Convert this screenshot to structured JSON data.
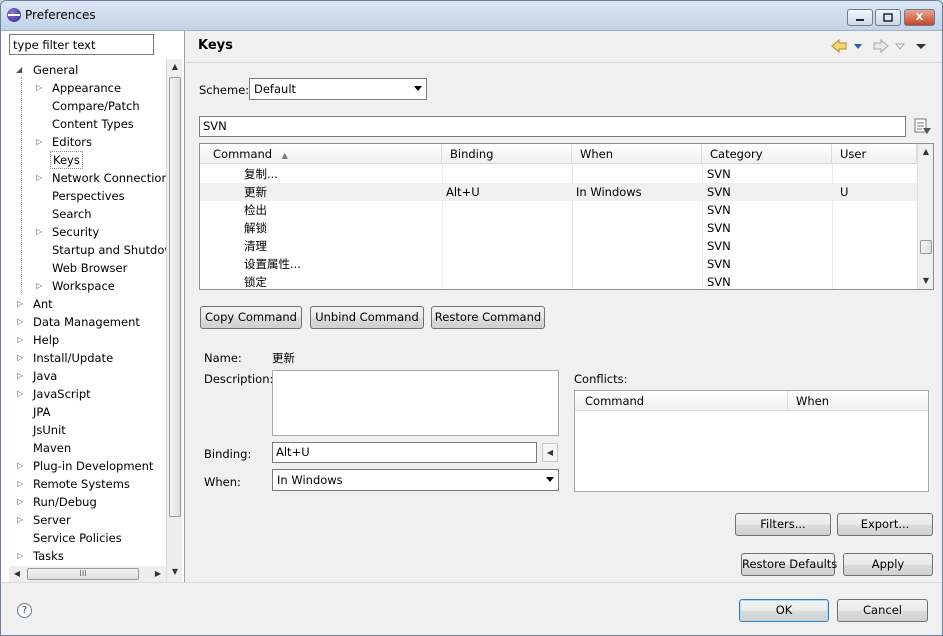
{
  "window": {
    "title": "Preferences",
    "minimize": "▭",
    "maximize": "□",
    "close": "X"
  },
  "filter": {
    "placeholder": "type filter text"
  },
  "tree": {
    "general": "General",
    "general_children": [
      "Appearance",
      "Compare/Patch",
      "Content Types",
      "Editors",
      "Keys",
      "Network Connections",
      "Perspectives",
      "Search",
      "Security",
      "Startup and Shutdown",
      "Web Browser",
      "Workspace"
    ],
    "top_level": [
      "Ant",
      "Data Management",
      "Help",
      "Install/Update",
      "Java",
      "JavaScript",
      "JPA",
      "JsUnit",
      "Maven",
      "Plug-in Development",
      "Remote Systems",
      "Run/Debug",
      "Server",
      "Service Policies",
      "Tasks"
    ],
    "hscroll_grip": "III"
  },
  "page": {
    "title": "Keys"
  },
  "scheme": {
    "label": "Scheme:",
    "value": "Default"
  },
  "search": {
    "value": "SVN"
  },
  "table": {
    "headers": [
      "Command",
      "Binding",
      "When",
      "Category",
      "User"
    ],
    "rows": [
      {
        "command": "复制...",
        "binding": "",
        "when": "",
        "category": "SVN",
        "user": ""
      },
      {
        "command": "更新",
        "binding": "Alt+U",
        "when": "In Windows",
        "category": "SVN",
        "user": "U"
      },
      {
        "command": "检出",
        "binding": "",
        "when": "",
        "category": "SVN",
        "user": ""
      },
      {
        "command": "解锁",
        "binding": "",
        "when": "",
        "category": "SVN",
        "user": ""
      },
      {
        "command": "清理",
        "binding": "",
        "when": "",
        "category": "SVN",
        "user": ""
      },
      {
        "command": "设置属性...",
        "binding": "",
        "when": "",
        "category": "SVN",
        "user": ""
      },
      {
        "command": "锁定",
        "binding": "",
        "when": "",
        "category": "SVN",
        "user": ""
      }
    ]
  },
  "buttons": {
    "copy": "Copy Command",
    "unbind": "Unbind Command",
    "restore": "Restore Command",
    "filters": "Filters...",
    "export": "Export...",
    "restore_defaults": "Restore Defaults",
    "apply": "Apply",
    "ok": "OK",
    "cancel": "Cancel"
  },
  "details": {
    "name_label": "Name:",
    "name_value": "更新",
    "description_label": "Description:",
    "binding_label": "Binding:",
    "binding_value": "Alt+U",
    "when_label": "When:",
    "when_value": "In Windows",
    "conflicts_label": "Conflicts:",
    "conflicts_headers": [
      "Command",
      "When"
    ]
  },
  "icons": {
    "back": "back-arrow-icon",
    "menu": "dropdown-icon",
    "forward": "forward-arrow-icon",
    "view_menu": "view-menu-icon",
    "help": "help-icon",
    "filter_options": "filter-options-icon"
  }
}
